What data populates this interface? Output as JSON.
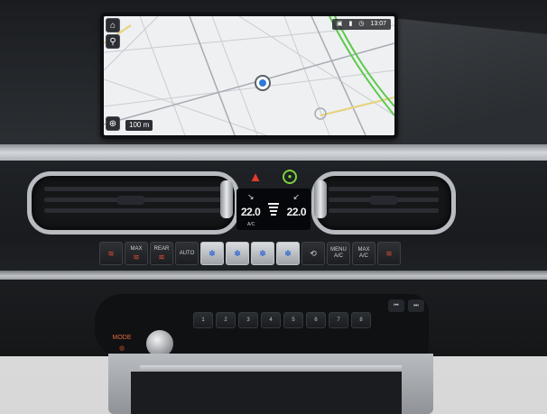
{
  "screen": {
    "status_time": "13:07",
    "scale_label": "100 m",
    "side_buttons": [
      "home-icon",
      "search-icon",
      "compass-icon"
    ]
  },
  "climate": {
    "temp_left": "22.0",
    "temp_right": "22.0",
    "ac_label": "A/C"
  },
  "controls": {
    "buttons": [
      {
        "label": "",
        "icon": "seat-heat-icon"
      },
      {
        "label": "MAX",
        "icon": "max-defrost-icon"
      },
      {
        "label": "REAR",
        "icon": "rear-defrost-icon"
      },
      {
        "label": "AUTO",
        "icon": ""
      },
      {
        "label": "",
        "icon": "fan-down-icon",
        "silver": true
      },
      {
        "label": "",
        "icon": "fan-icon",
        "silver": true
      },
      {
        "label": "",
        "icon": "fan-up-icon",
        "silver": true
      },
      {
        "label": "",
        "icon": "airflow-icon",
        "silver": true
      },
      {
        "label": "",
        "icon": "recirculation-icon"
      },
      {
        "label": "MENU A/C",
        "icon": ""
      },
      {
        "label": "MAX A/C",
        "icon": ""
      },
      {
        "label": "",
        "icon": "seat-heat-icon"
      }
    ]
  },
  "radio": {
    "mode_label": "MODE",
    "presets": [
      "1",
      "2",
      "3",
      "4",
      "5",
      "6",
      "7",
      "8"
    ]
  },
  "colors": {
    "hazard": "#e53b2a",
    "indicator_green": "#7bd23b",
    "mode_orange": "#e06a3c"
  }
}
